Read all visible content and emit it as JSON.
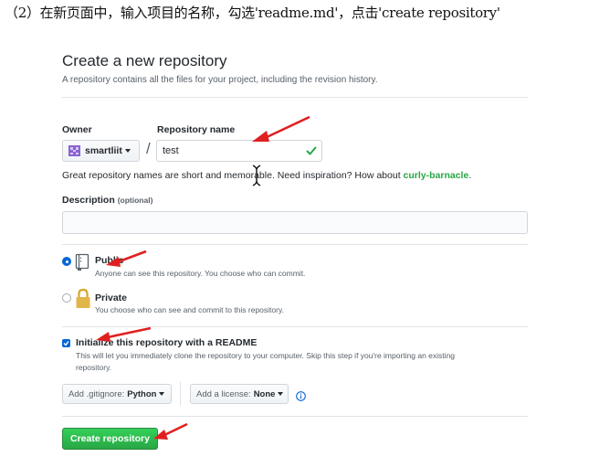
{
  "caption": "（2）在新页面中，输入项目的名称，勾选'readme.md'，点击'create repository'",
  "header": {
    "title": "Create a new repository",
    "subtitle": "A repository contains all the files for your project, including the revision history."
  },
  "owner": {
    "label": "Owner",
    "value": "smartliit"
  },
  "repo": {
    "label": "Repository name",
    "value": "test"
  },
  "hint": {
    "text": "Great repository names are short and memorable. Need inspiration? How about ",
    "suggestion": "curly-barnacle",
    "suffix": "."
  },
  "description": {
    "label": "Description",
    "optional": "(optional)",
    "value": ""
  },
  "visibility": {
    "public": {
      "title": "Public",
      "desc": "Anyone can see this repository. You choose who can commit.",
      "selected": true
    },
    "private": {
      "title": "Private",
      "desc": "You choose who can see and commit to this repository.",
      "selected": false
    }
  },
  "readme": {
    "checked": true,
    "title": "Initialize this repository with a README",
    "desc_line1": "This will let you immediately clone the repository to your computer. Skip this step if you're importing an existing",
    "desc_line2": "repository."
  },
  "gitignore": {
    "label": "Add .gitignore:",
    "value": "Python"
  },
  "license": {
    "label": "Add a license:",
    "value": "None"
  },
  "create_button": "Create repository",
  "colors": {
    "accent_blue": "#0366d6",
    "success_green": "#28a745",
    "annotation_red": "#e02020"
  }
}
